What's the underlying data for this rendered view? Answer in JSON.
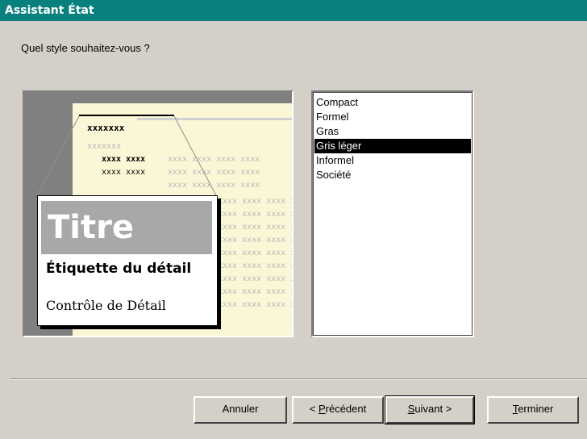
{
  "window": {
    "title": "Assistant État"
  },
  "prompt": {
    "question": "Quel style souhaitez-vous ?"
  },
  "preview": {
    "header_text": "xxxxxxx",
    "sub_text": "xxxxxxx",
    "row_dark": "xxxx xxxx",
    "row_gray": "xxxx xxxx xxxx xxxx",
    "zoom_title": "Titre",
    "zoom_label": "Étiquette du détail",
    "zoom_control": "Contrôle de Détail"
  },
  "styles": {
    "items": [
      "Compact",
      "Formel",
      "Gras",
      "Gris léger",
      "Informel",
      "Société"
    ],
    "selected_index": 3
  },
  "buttons": {
    "cancel": "Annuler",
    "back_prefix": "< ",
    "back_mnemonic": "P",
    "back_rest": "récédent",
    "next_mnemonic": "S",
    "next_rest": "uivant >",
    "finish_mnemonic": "T",
    "finish_rest": "erminer"
  },
  "colors": {
    "titlebar": "#08807e",
    "dialog": "#d4d0c8",
    "preview_page": "#fbf6d6"
  }
}
